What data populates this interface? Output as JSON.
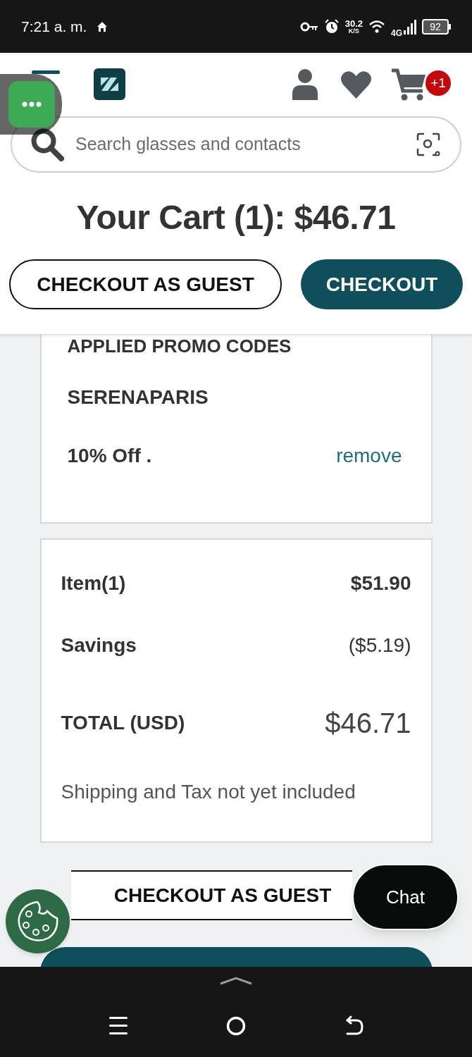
{
  "status_bar": {
    "time": "7:21 a. m.",
    "speed_value": "30.2",
    "speed_unit": "K/S",
    "network": "4G",
    "battery": "92"
  },
  "header": {
    "cart_badge": "+1",
    "search": {
      "placeholder": "Search glasses and contacts"
    },
    "title": "Your Cart (1): $46.71",
    "buttons": [
      {
        "label": "CHECKOUT AS GUEST",
        "kind": "outline"
      },
      {
        "label": "CHECKOUT",
        "kind": "primary"
      }
    ]
  },
  "promo": {
    "heading": "APPLIED PROMO CODES",
    "code": "SERENAPARIS",
    "discount": "10% Off .",
    "remove": "remove"
  },
  "summary": {
    "rows": [
      {
        "label": "Item(1)",
        "value": "$51.90",
        "kind": "item"
      },
      {
        "label": "Savings",
        "value": "($5.19)",
        "kind": "savings"
      },
      {
        "label": "TOTAL (USD)",
        "value": "$46.71",
        "kind": "total"
      }
    ],
    "note": "Shipping and Tax not yet included"
  },
  "bottom_buttons": [
    {
      "label": "CHECKOUT AS GUEST",
      "kind": "outline"
    },
    {
      "kind": "primary"
    }
  ],
  "chat": {
    "label": "Chat"
  }
}
